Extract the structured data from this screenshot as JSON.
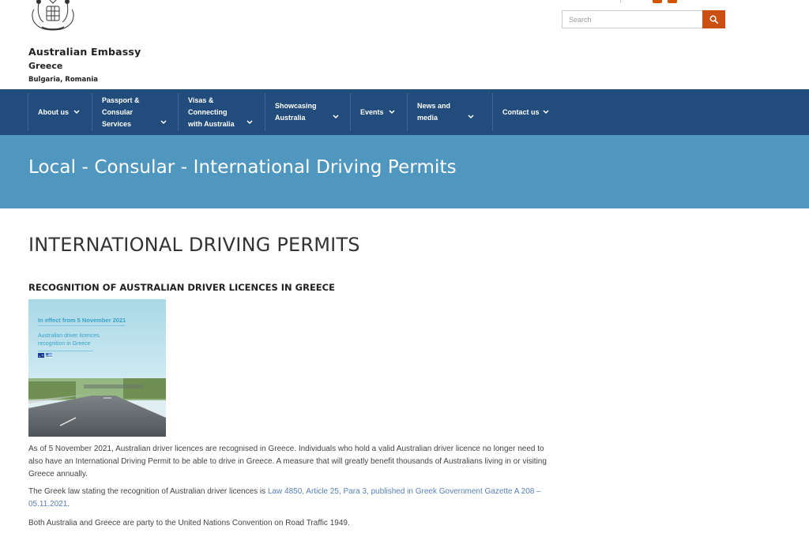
{
  "header": {
    "org_name": "Australian Embassy",
    "country": "Greece",
    "also_accredited": "Bulgaria, Romania",
    "search_placeholder": "Search",
    "colors": {
      "accent": "#cc4f12",
      "nav_bg": "#214c7b",
      "banner_bg": "#5097bf"
    }
  },
  "nav": {
    "items": [
      {
        "label": "About us"
      },
      {
        "label": "Passport &\nConsular\nServices"
      },
      {
        "label": "Visas &\nConnecting\nwith Australia"
      },
      {
        "label": "Showcasing\nAustralia"
      },
      {
        "label": "Events"
      },
      {
        "label": "News and\nmedia"
      },
      {
        "label": "Contact us"
      }
    ]
  },
  "banner": {
    "title": "Local - Consular - International Driving Permits"
  },
  "main": {
    "heading": "INTERNATIONAL DRIVING PERMITS",
    "subheading": "RECOGNITION OF AUSTRALIAN DRIVER LICENCES IN GREECE",
    "poster": {
      "line1": "In effect from 5 November 2021",
      "line2": "Australian driver licences\nrecognition in Greece"
    },
    "paragraphs": {
      "p1": "As of 5 November 2021, Australian driver licences are recognised in Greece. Individuals who hold a valid Australian driver licence no longer need to also have an International Driving Permit to be able to drive in Greece. A measure that will greatly benefit thousands of Australians living in or visiting Greece annually.",
      "p2_before": "The Greek law stating the recognition of Australian driver licences is ",
      "p2_link": "Law 4850, Article 25, Para 3, published in Greek Government Gazette A 208 – 05.11.2021",
      "p2_after": ".",
      "p3": "Both Australia and Greece are party to the United Nations Convention on Road Traffic 1949."
    }
  },
  "icons": {
    "crest": "coat-of-arms-icon",
    "search": "search-icon",
    "chevron": "chevron-down-icon"
  }
}
